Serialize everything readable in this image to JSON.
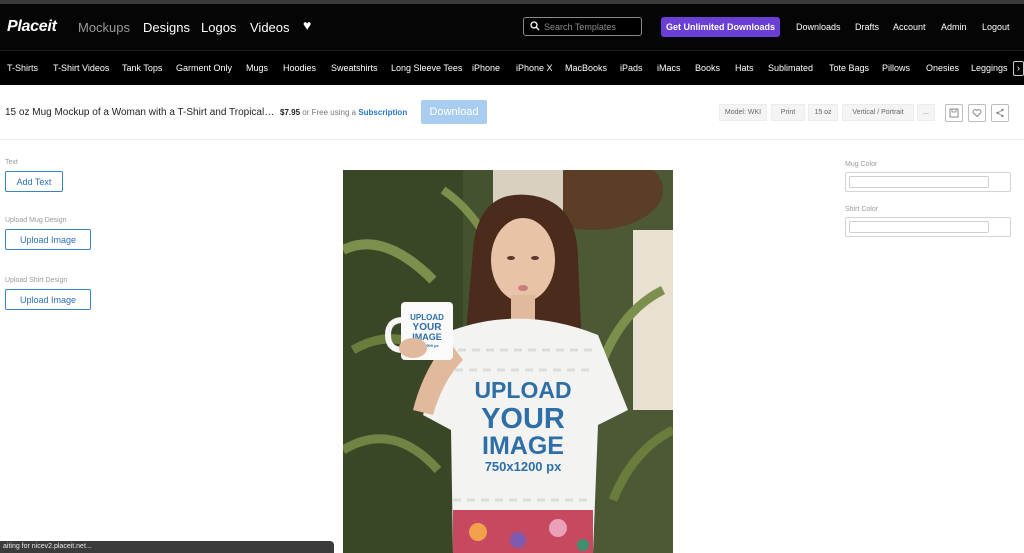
{
  "app": {
    "logo": "Placeit"
  },
  "topnav": {
    "links": [
      "Mockups",
      "Designs",
      "Logos",
      "Videos"
    ],
    "search_placeholder": "Search Templates",
    "cta": "Get Unlimited Downloads",
    "right_links": [
      "Downloads",
      "Drafts",
      "Account",
      "Admin",
      "Logout"
    ],
    "accent_color": "#6a3fd6"
  },
  "categories": [
    "T-Shirts",
    "T-Shirt Videos",
    "Tank Tops",
    "Garment Only",
    "Mugs",
    "Hoodies",
    "Sweatshirts",
    "Long Sleeve Tees",
    "iPhone",
    "iPhone X",
    "MacBooks",
    "iPads",
    "iMacs",
    "Books",
    "Hats",
    "Sublimated",
    "Tote Bags",
    "Pillows",
    "Onesies",
    "Leggings"
  ],
  "product": {
    "title": "15 oz Mug Mockup of a Woman with a T-Shirt and Tropical…",
    "price": "$7.95",
    "price_suffix": "or Free using a",
    "subscription_label": "Subscription",
    "download_label": "Download",
    "chips": [
      "Model: WKI",
      "Print",
      "15 oz",
      "Vertical / Portrait",
      "..."
    ]
  },
  "left_panel": {
    "text_label": "Text",
    "add_text_button": "Add Text",
    "mug_design_label": "Upload Mug Design",
    "upload_mug_button": "Upload Image",
    "shirt_design_label": "Upload Shirt Design",
    "upload_shirt_button": "Upload Image"
  },
  "right_panel": {
    "mug_color_label": "Mug Color",
    "shirt_color_label": "Shirt Color"
  },
  "preview": {
    "mug_text": [
      "UPLOAD",
      "YOUR",
      "IMAGE",
      "1050x900 px"
    ],
    "shirt_text": [
      "UPLOAD",
      "YOUR",
      "IMAGE",
      "750x1200 px"
    ]
  },
  "status_text": "aiting for nicev2.placeit.net..."
}
